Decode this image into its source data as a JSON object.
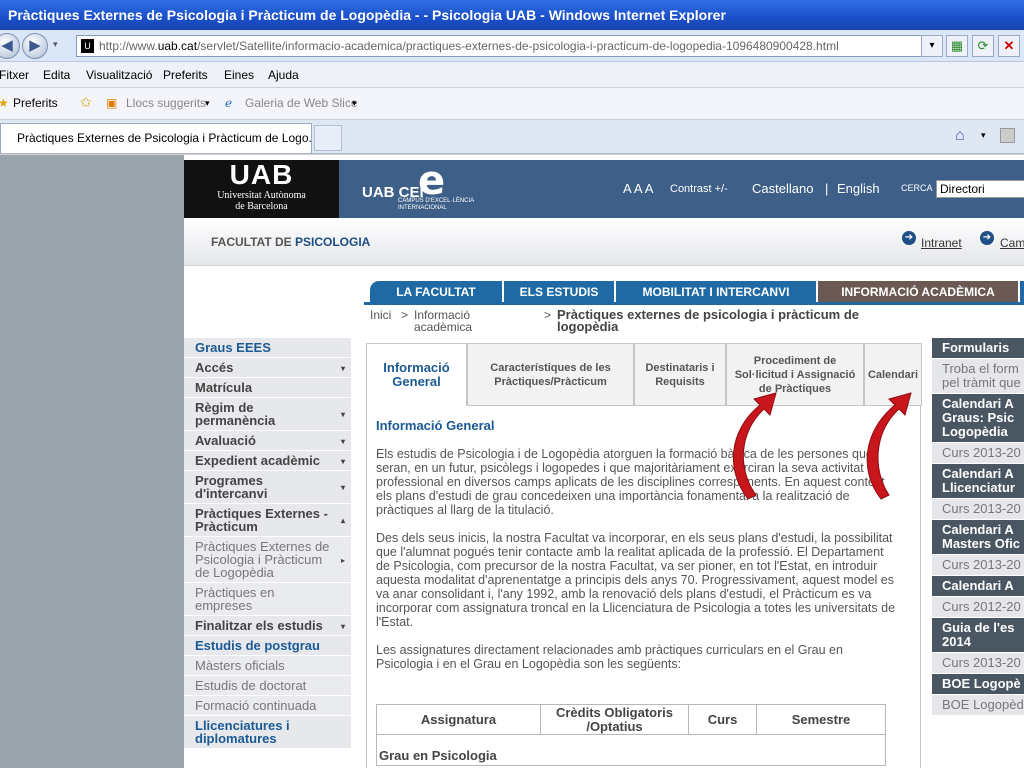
{
  "browser": {
    "window_title": "Pràctiques Externes de Psicologia i Pràcticum de Logopèdia - - Psicologia UAB - Windows Internet Explorer",
    "url_prefix": "http://www.",
    "url_domain": "uab.cat",
    "url_rest": "/servlet/Satellite/informacio-academica/practiques-externes-de-psicologia-i-practicum-de-logopedia-1096480900428.html",
    "menu": [
      "Fitxer",
      "Edita",
      "Visualització",
      "Preferits",
      "Eines",
      "Ajuda"
    ],
    "favorites_label": "Preferits",
    "suggested_sites": "Llocs suggerits",
    "web_slice": "Galeria de Web Slice",
    "tab_title": "Pràctiques Externes de Psicologia i Pràcticum de Logo..."
  },
  "header": {
    "logo_big": "UAB",
    "logo_line1": "Universitat Autònoma",
    "logo_line2": "de Barcelona",
    "cei_text": "UAB CEI",
    "cei_e": "e",
    "cei_sub": "CAMPUS D'EXCEL·LÈNCIA INTERNACIONAL",
    "font_size": "A A A",
    "contrast": "Contrast +/-",
    "lang_castellano": "Castellano",
    "lang_sep": "|",
    "lang_english": "English",
    "search_label": "CERCA",
    "search_value": "Directori"
  },
  "faculty": {
    "prefix": "FACULTAT DE",
    "name": "PSICOLOGIA",
    "intranet": "Intranet",
    "campus": "Cam"
  },
  "main_nav": [
    "LA FACULTAT",
    "ELS ESTUDIS",
    "MOBILITAT I INTERCANVI",
    "INFORMACIÓ ACADÈMICA"
  ],
  "breadcrumb": {
    "home": "Inici",
    "sep": ">",
    "level1": "Informació acadèmica",
    "sep2": ">",
    "current": "Pràctiques externes de psicologia i pràcticum de logopèdia"
  },
  "left_menu": [
    {
      "label": "Graus EEES",
      "style": "hdr",
      "arrow": ""
    },
    {
      "label": "Accés",
      "style": "normal",
      "arrow": "▾"
    },
    {
      "label": "Matrícula",
      "style": "normal",
      "arrow": ""
    },
    {
      "label": "Règim de permanència",
      "style": "normal",
      "arrow": "▾"
    },
    {
      "label": "Avaluació",
      "style": "normal",
      "arrow": "▾"
    },
    {
      "label": "Expedient acadèmic",
      "style": "normal",
      "arrow": "▾"
    },
    {
      "label": "Programes d'intercanvi",
      "style": "normal",
      "arrow": "▾"
    },
    {
      "label": "Pràctiques Externes - Pràcticum",
      "style": "normal",
      "arrow": "▴"
    },
    {
      "label": "Pràctiques Externes de Psicologia i Pràcticum de Logopèdia",
      "style": "sub",
      "arrow": "▸"
    },
    {
      "label": "Pràctiques en empreses",
      "style": "sub",
      "arrow": ""
    },
    {
      "label": "Finalitzar els estudis",
      "style": "normal",
      "arrow": "▾"
    },
    {
      "label": "Estudis de postgrau",
      "style": "hdr",
      "arrow": ""
    },
    {
      "label": "Màsters oficials",
      "style": "sub",
      "arrow": ""
    },
    {
      "label": "Estudis de doctorat",
      "style": "sub",
      "arrow": ""
    },
    {
      "label": "Formació continuada",
      "style": "sub",
      "arrow": ""
    },
    {
      "label": "Llicenciatures i diplomatures",
      "style": "hdr",
      "arrow": ""
    }
  ],
  "content_tabs": [
    "Informació General",
    "Característiques de les Pràctiques/Pràcticum",
    "Destinataris i Requisits",
    "Procediment de Sol·licitud i Assignació de Pràctiques",
    "Calendari"
  ],
  "content": {
    "heading": "Informació General",
    "p1": "Els estudis de Psicologia i de Logopèdia atorguen la formació bàsica de les persones que seran, en un futur, psicòlegs i logopedes i que majoritàriament exerciran la seva activitat professional en diversos camps aplicats de les disciplines corresponents. En aquest context els plans d'estudi de grau concedeixen una importància fonamental a la realització de pràctiques al llarg de la titulació.",
    "p2": "Des dels seus inicis, la nostra Facultat va incorporar, en els seus plans d'estudi, la possibilitat que l'alumnat pogués tenir contacte amb la realitat aplicada de la professió. El Departament de Psicologia, com precursor de la nostra Facultat, va ser pioner, en tot l'Estat, en introduir aquesta modalitat d'aprenentatge a principis dels anys 70. Progressivament, aquest model es va anar consolidant i, l'any 1992, amb la renovació dels plans d'estudi, el Pràcticum es va incorporar com assignatura troncal en la Llicenciatura de Psicologia a totes les universitats de l'Estat.",
    "p3": "Les assignatures directament relacionades amb pràctiques curriculars en el Grau en Psicologia i en el Grau en Logopèdia  son les següents:"
  },
  "table": {
    "headers": [
      "Assignatura",
      "Crèdits Obligatoris /Optatius",
      "Curs",
      "Semestre"
    ],
    "group": "Grau en Psicologia"
  },
  "right_col": [
    {
      "label": "Formularis",
      "style": "dark"
    },
    {
      "label": "Troba el form pel tràmit que",
      "style": "light"
    },
    {
      "label": "Calendari A Graus: Psic Logopèdia",
      "style": "dark"
    },
    {
      "label": "Curs 2013-20",
      "style": "light"
    },
    {
      "label": "Calendari A Llicenciatur",
      "style": "dark"
    },
    {
      "label": "Curs 2013-20",
      "style": "light"
    },
    {
      "label": "Calendari A Masters Ofic",
      "style": "dark"
    },
    {
      "label": "Curs 2013-20",
      "style": "light"
    },
    {
      "label": "Calendari A",
      "style": "dark"
    },
    {
      "label": "Curs 2012-20",
      "style": "light"
    },
    {
      "label": "Guia de l'es 2014",
      "style": "dark"
    },
    {
      "label": "Curs 2013-20",
      "style": "light"
    },
    {
      "label": "BOE Logopè",
      "style": "dark"
    },
    {
      "label": "BOE Logopèd",
      "style": "light"
    }
  ],
  "colors": {
    "header_blue": "#3d5f88",
    "nav_blue": "#1f6aa5",
    "nav_active": "#6b5a53",
    "heading_blue": "#1c5a94",
    "arrow_red": "#c8161d"
  }
}
